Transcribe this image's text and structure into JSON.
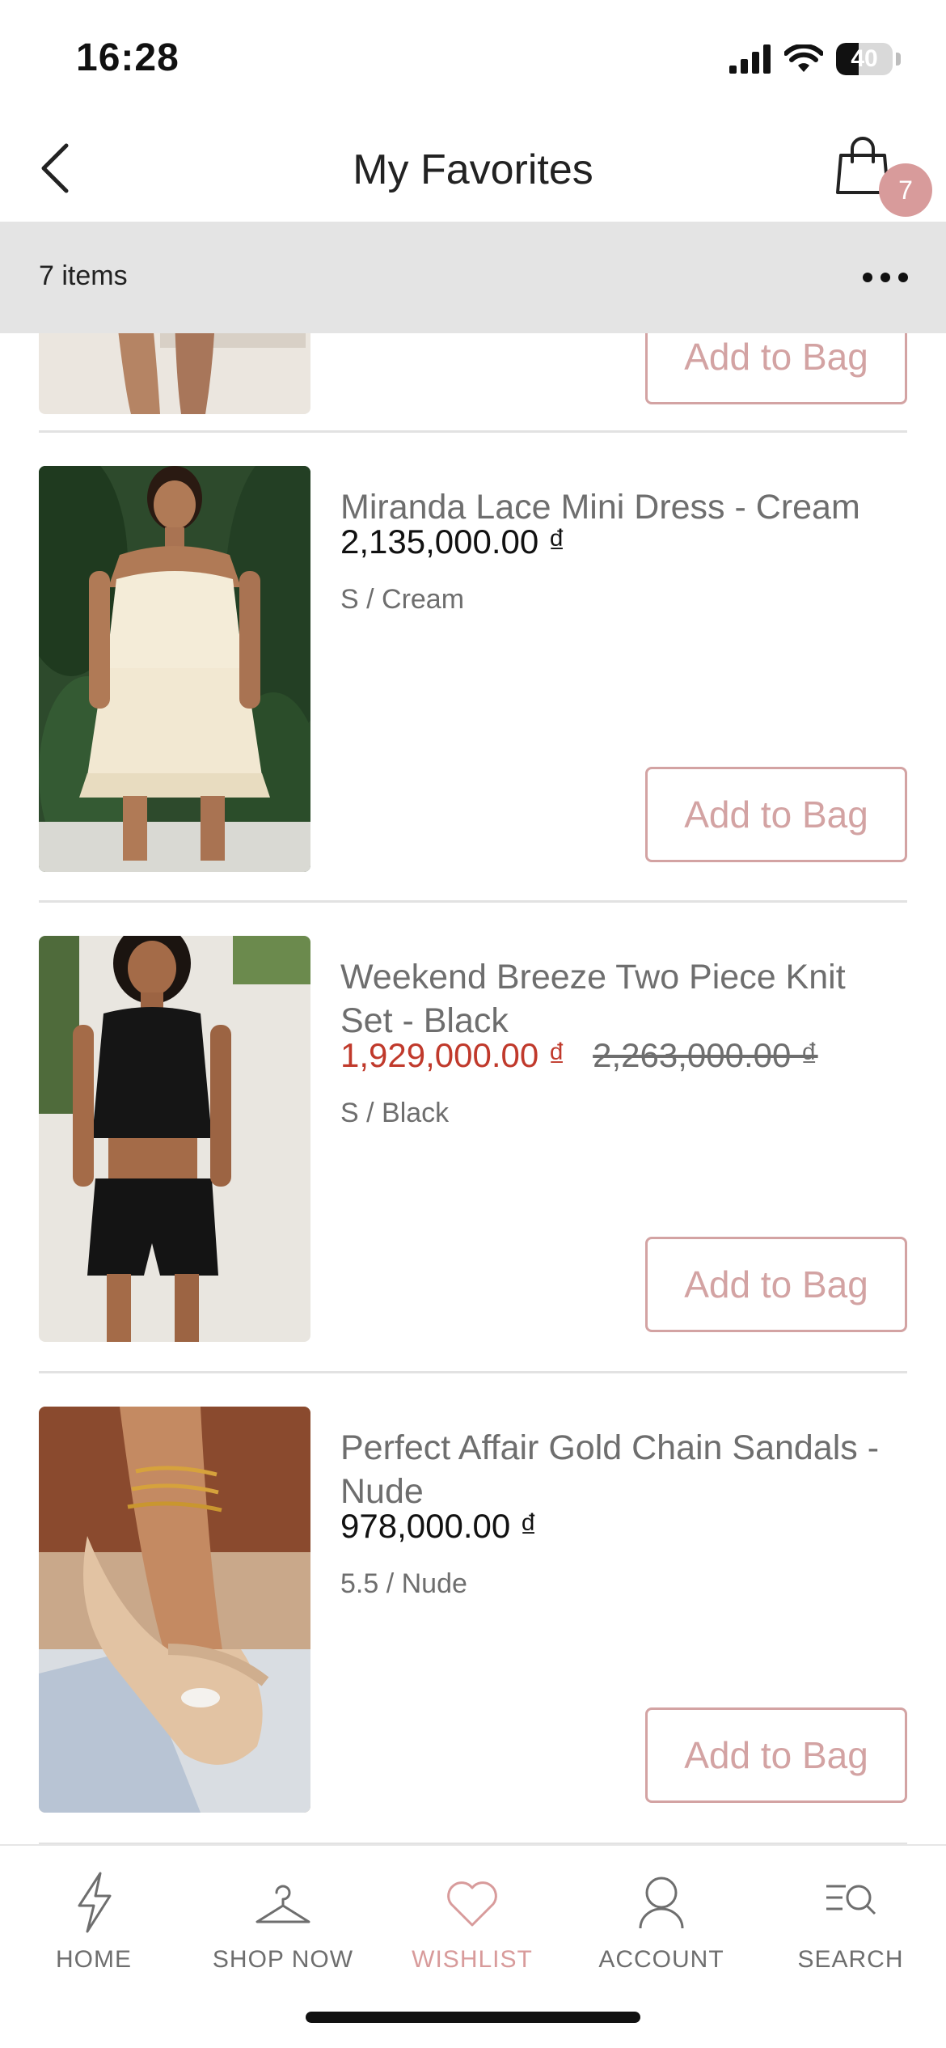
{
  "status_bar": {
    "time": "16:28",
    "battery": "40",
    "battery_level": 0.4
  },
  "header": {
    "title": "My Favorites",
    "bag_count": "7"
  },
  "subbar": {
    "count_label": "7 items"
  },
  "icons": {
    "back": "chevron-left-icon",
    "bag": "shopping-bag-icon",
    "more": "more-horizontal-icon",
    "home": "lightning-icon",
    "shop": "hanger-icon",
    "wishlist": "heart-icon",
    "account": "person-icon",
    "search": "search-list-icon"
  },
  "colors": {
    "accent": "#d89b9b",
    "sale": "#c0392b",
    "button_border": "#d3a3a3"
  },
  "products": [
    {
      "add_label": "Add to Bag"
    },
    {
      "name": "Miranda Lace Mini Dress - Cream",
      "price": "2,135,000.00 ₫",
      "variant": "S / Cream",
      "add_label": "Add to Bag"
    },
    {
      "name": "Weekend Breeze Two Piece Knit Set - Black",
      "price": "1,929,000.00 ₫",
      "original_price": "2,263,000.00 ₫",
      "variant": "S / Black",
      "add_label": "Add to Bag"
    },
    {
      "name": "Perfect Affair Gold Chain Sandals - Nude",
      "price": "978,000.00 ₫",
      "variant": "5.5 / Nude",
      "add_label": "Add to Bag"
    }
  ],
  "tabs": [
    {
      "label": "HOME",
      "active": false
    },
    {
      "label": "SHOP NOW",
      "active": false
    },
    {
      "label": "WISHLIST",
      "active": true
    },
    {
      "label": "ACCOUNT",
      "active": false
    },
    {
      "label": "SEARCH",
      "active": false
    }
  ]
}
